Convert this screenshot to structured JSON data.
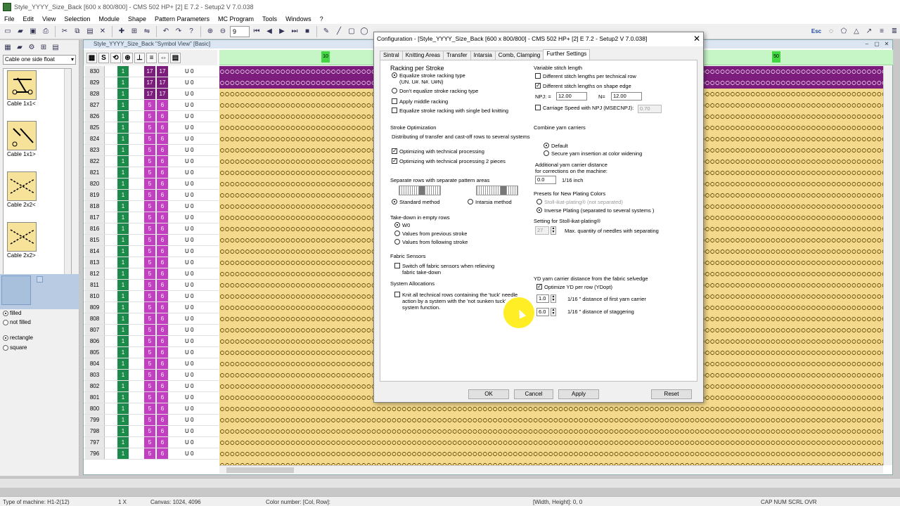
{
  "window": {
    "title": "Style_YYYY_Size_Back [600 x 800/800] - CMS 502 HP+ [2] E 7.2 - Setup2    V 7.0.038"
  },
  "menu": [
    "File",
    "Edit",
    "View",
    "Selection",
    "Module",
    "Shape",
    "Pattern Parameters",
    "MC Program",
    "Tools",
    "Windows",
    "?"
  ],
  "toolbar": {
    "zoom_value": "9",
    "esc_label": "Esc"
  },
  "left_panel": {
    "category": "Cable one side float",
    "modules": [
      {
        "label": "Cable 1x1<"
      },
      {
        "label": "Cable 1x1>"
      },
      {
        "label": "Cable 2x2<"
      },
      {
        "label": "Cable 2x2>"
      }
    ],
    "fill_options": [
      {
        "label": "filled",
        "selected": true
      },
      {
        "label": "not filled",
        "selected": false
      }
    ],
    "shape_options": [
      {
        "label": "rectangle",
        "selected": true
      },
      {
        "label": "square",
        "selected": false
      }
    ]
  },
  "doc": {
    "title": "Style_YYYY_Size_Back \"Symbol View\" [Basic]",
    "column_headers": [
      "▦",
      "S",
      "⟲",
      "⊛",
      "⊥",
      "≡",
      "⇔",
      "▤"
    ],
    "ruler_marks": [
      "10",
      "50"
    ],
    "rows": [
      {
        "num": "830",
        "green": "1",
        "p1": "17",
        "p2": "17",
        "u": "U 0",
        "purple": true
      },
      {
        "num": "829",
        "green": "1",
        "p1": "17",
        "p2": "17",
        "u": "U 0",
        "purple": true
      },
      {
        "num": "828",
        "green": "1",
        "p1": "17",
        "p2": "17",
        "u": "U 0",
        "purple": true
      },
      {
        "num": "827",
        "green": "1",
        "p1": "5",
        "p2": "6",
        "u": "U 0"
      },
      {
        "num": "826",
        "green": "1",
        "p1": "5",
        "p2": "6",
        "u": "U 0"
      },
      {
        "num": "825",
        "green": "1",
        "p1": "5",
        "p2": "6",
        "u": "U 0"
      },
      {
        "num": "824",
        "green": "1",
        "p1": "5",
        "p2": "6",
        "u": "U 0"
      },
      {
        "num": "823",
        "green": "1",
        "p1": "5",
        "p2": "6",
        "u": "U 0"
      },
      {
        "num": "822",
        "green": "1",
        "p1": "5",
        "p2": "6",
        "u": "U 0"
      },
      {
        "num": "821",
        "green": "1",
        "p1": "5",
        "p2": "6",
        "u": "U 0"
      },
      {
        "num": "820",
        "green": "1",
        "p1": "5",
        "p2": "6",
        "u": "U 0"
      },
      {
        "num": "819",
        "green": "1",
        "p1": "5",
        "p2": "6",
        "u": "U 0"
      },
      {
        "num": "818",
        "green": "1",
        "p1": "5",
        "p2": "6",
        "u": "U 0"
      },
      {
        "num": "817",
        "green": "1",
        "p1": "5",
        "p2": "6",
        "u": "U 0"
      },
      {
        "num": "816",
        "green": "1",
        "p1": "5",
        "p2": "6",
        "u": "U 0"
      },
      {
        "num": "815",
        "green": "1",
        "p1": "5",
        "p2": "6",
        "u": "U 0"
      },
      {
        "num": "814",
        "green": "1",
        "p1": "5",
        "p2": "6",
        "u": "U 0"
      },
      {
        "num": "813",
        "green": "1",
        "p1": "5",
        "p2": "6",
        "u": "U 0"
      },
      {
        "num": "812",
        "green": "1",
        "p1": "5",
        "p2": "6",
        "u": "U 0"
      },
      {
        "num": "811",
        "green": "1",
        "p1": "5",
        "p2": "6",
        "u": "U 0"
      },
      {
        "num": "810",
        "green": "1",
        "p1": "5",
        "p2": "6",
        "u": "U 0"
      },
      {
        "num": "809",
        "green": "1",
        "p1": "5",
        "p2": "6",
        "u": "U 0"
      },
      {
        "num": "808",
        "green": "1",
        "p1": "5",
        "p2": "6",
        "u": "U 0"
      },
      {
        "num": "807",
        "green": "1",
        "p1": "5",
        "p2": "6",
        "u": "U 0"
      },
      {
        "num": "806",
        "green": "1",
        "p1": "5",
        "p2": "6",
        "u": "U 0"
      },
      {
        "num": "805",
        "green": "1",
        "p1": "5",
        "p2": "6",
        "u": "U 0"
      },
      {
        "num": "804",
        "green": "1",
        "p1": "5",
        "p2": "6",
        "u": "U 0"
      },
      {
        "num": "803",
        "green": "1",
        "p1": "5",
        "p2": "6",
        "u": "U 0"
      },
      {
        "num": "802",
        "green": "1",
        "p1": "5",
        "p2": "6",
        "u": "U 0"
      },
      {
        "num": "801",
        "green": "1",
        "p1": "5",
        "p2": "6",
        "u": "U 0"
      },
      {
        "num": "800",
        "green": "1",
        "p1": "5",
        "p2": "6",
        "u": "U 0"
      },
      {
        "num": "799",
        "green": "1",
        "p1": "5",
        "p2": "6",
        "u": "U 0"
      },
      {
        "num": "798",
        "green": "1",
        "p1": "5",
        "p2": "6",
        "u": "U 0"
      },
      {
        "num": "797",
        "green": "1",
        "p1": "5",
        "p2": "6",
        "u": "U 0"
      },
      {
        "num": "796",
        "green": "1",
        "p1": "5",
        "p2": "6",
        "u": "U 0"
      }
    ]
  },
  "status": {
    "machine": "Type of machine: H1-2(12)",
    "zoom": "1 X",
    "canvas": "Canvas: 1024, 4096",
    "color": "Color number:  [Col, Row]:",
    "wh": "[Width, Height]: 0, 0",
    "keys": "CAP  NUM  SCRL  OVR"
  },
  "dialog": {
    "title": "Configuration - [Style_YYYY_Size_Back [600 x 800/800] - CMS 502 HP+ [2] E 7.2 - Setup2    V 7.0.038]",
    "close": "✕",
    "tabs": [
      "Sintral",
      "Knitting Areas",
      "Transfer",
      "Intarsia",
      "Comb, Clamping",
      "Further Settings"
    ],
    "racking": {
      "title": "Racking per Stroke",
      "equalize": "Equalize stroke racking type",
      "equalize_sub": "(UN. U#. N#. U#N)",
      "dont": "Don't equalize stroke racking type",
      "middle": "Apply middle racking",
      "single": "Equalize stroke racking with single bed knitting"
    },
    "stroke": {
      "title": "Stroke Optimization",
      "desc": "Distributing of transfer and cast-off rows to several systems",
      "opt1": "Optimizing with technical processing",
      "opt2": "Optimizing with technical processing 2 pieces"
    },
    "separate": {
      "title": "Separate rows with separate pattern areas",
      "standard": "Standard method",
      "intarsia": "Intarsia method"
    },
    "takedown": {
      "title": "Take-down in empty rows",
      "w0": "W0",
      "prev": "Values from previous stroke",
      "next": "Values from following stroke"
    },
    "fabric": {
      "title": "Fabric Sensors",
      "switch": "Switch off fabric sensors when relieving fabric take-down"
    },
    "system": {
      "title": "System Allocations",
      "knit": "Knit all technical rows containing the 'tuck' needle action by a system with the 'not sunken tuck' system function."
    },
    "variable": {
      "title": "Variable stitch length",
      "per_tech": "Different stitch lengths per technical row",
      "on_edge": "Different stitch lengths on shape edge",
      "npj_label": "NPJ:  =",
      "npj_value": "12.00",
      "n_label": "N=",
      "n_value": "12.00",
      "carriage": "Carriage Speed with NPJ (MSECNPJ):",
      "carriage_value": "0.70"
    },
    "combine": {
      "title": "Combine yarn carriers",
      "default": "Default",
      "secure": "Secure yarn insertion at color widening",
      "additional": "Additional yarn carrier distance",
      "for_corr": "for corrections on the machine:",
      "value": "0.0",
      "unit": "1/16 inch"
    },
    "plating": {
      "title": "Presets for New Plating Colors",
      "stoll": "Stoll-ikat-plating® (not separated)",
      "inverse": "Inverse Plating  (separated to several systems )"
    },
    "ikat": {
      "title": "Setting for Stoll-ikat-plating®",
      "value": "27",
      "desc": "Max. quantity of needles with separating"
    },
    "yd": {
      "title": "YD yarn carrier distance from the fabric selvedge",
      "optimize": "Optimize YD per row (YDopt)",
      "v1": "1.0",
      "d1": "1/16 \" distance of first yarn carrier",
      "v2": "6.0",
      "d2": "1/16 \" distance of staggering"
    },
    "buttons": {
      "ok": "OK",
      "cancel": "Cancel",
      "apply": "Apply",
      "reset": "Reset"
    }
  },
  "colors": {
    "green": "#1b8a4a",
    "purple": "#7c1c7c",
    "magenta": "#c23fc2",
    "pattern": "#f4d98c",
    "ruler": "#c6f5c6"
  }
}
